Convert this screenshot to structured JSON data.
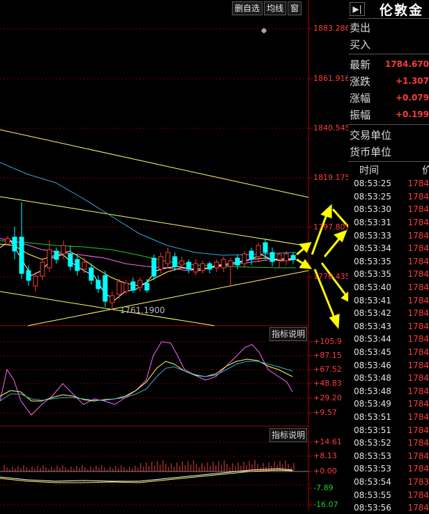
{
  "toolbar": {
    "delete_label": "删自选",
    "ma_label": "均线",
    "window_label": "窗"
  },
  "price_axis": [
    "1883.286",
    "1861.916",
    "1840.545",
    "1819.175",
    "1797.805",
    "1776.435"
  ],
  "low_marker": "1761.1900",
  "indicator1": {
    "button_label": "指标说明",
    "ticks": [
      "+105.9",
      "+87.15",
      "+67.52",
      "+48.83",
      "+29.20",
      "+9.57"
    ]
  },
  "indicator2": {
    "button_label": "指标说明",
    "ticks": [
      "+14.61",
      "+8.13",
      "+0.00",
      "-7.89",
      "-16.07"
    ]
  },
  "quote": {
    "title": "伦敦金",
    "sell_label": "卖出",
    "buy_label": "买入",
    "last_label": "最新",
    "last_value": "1784.670",
    "change_label": "涨跌",
    "change_value": "+1.307",
    "pct_label": "涨幅",
    "pct_value": "+0.079",
    "amp_label": "振幅",
    "amp_value": "+0.199",
    "unit_label": "交易单位",
    "currency_label": "货币单位"
  },
  "ticks_header": {
    "time": "时间",
    "price": "价"
  },
  "ticks": [
    {
      "time": "08:53:25",
      "price": "1784"
    },
    {
      "time": "08:53:25",
      "price": "1784"
    },
    {
      "time": "08:53:30",
      "price": "1784"
    },
    {
      "time": "08:53:31",
      "price": "1784"
    },
    {
      "time": "08:53:33",
      "price": "1784"
    },
    {
      "time": "08:53:34",
      "price": "1784"
    },
    {
      "time": "08:53:35",
      "price": "1784"
    },
    {
      "time": "08:53:35",
      "price": "1784"
    },
    {
      "time": "08:53:40",
      "price": "1784"
    },
    {
      "time": "08:53:41",
      "price": "1784"
    },
    {
      "time": "08:53:42",
      "price": "1784"
    },
    {
      "time": "08:53:43",
      "price": "1784"
    },
    {
      "time": "08:53:44",
      "price": "1784"
    },
    {
      "time": "08:53:45",
      "price": "1784"
    },
    {
      "time": "08:53:46",
      "price": "1784"
    },
    {
      "time": "08:53:48",
      "price": "1784"
    },
    {
      "time": "08:53:48",
      "price": "1784"
    },
    {
      "time": "08:53:49",
      "price": "1784"
    },
    {
      "time": "08:53:51",
      "price": "1784"
    },
    {
      "time": "08:53:51",
      "price": "1784"
    },
    {
      "time": "08:53:52",
      "price": "1784"
    },
    {
      "time": "08:53:53",
      "price": "1784"
    },
    {
      "time": "08:53:53",
      "price": "1784"
    },
    {
      "time": "08:53:54",
      "price": "1783"
    },
    {
      "time": "08:53:55",
      "price": "1784"
    },
    {
      "time": "08:53:56",
      "price": "1784"
    }
  ],
  "colors": {
    "up": "#ff3c3c",
    "down": "#00ffff",
    "ma5": "#ffffff",
    "ma10": "#ffff55",
    "ma20": "#ff66ff",
    "ma30": "#22cc22",
    "ma60": "#33aadd",
    "channel": "#ffff66",
    "arrows": "#ffff00"
  }
}
